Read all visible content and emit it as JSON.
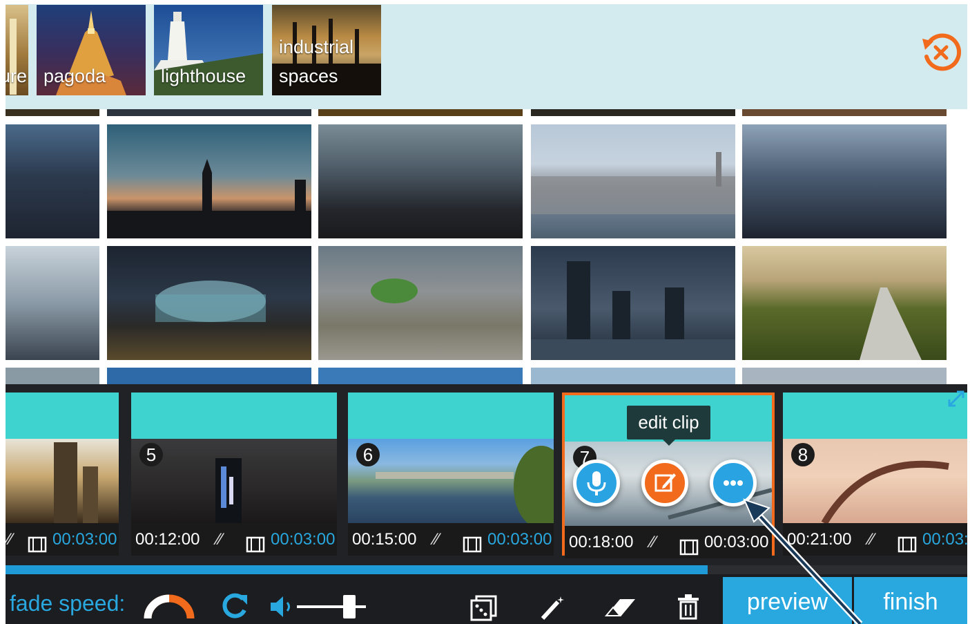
{
  "categories": [
    {
      "label": "ure"
    },
    {
      "label": "pagoda"
    },
    {
      "label": "lighthouse"
    },
    {
      "label_line1": "industrial",
      "label_line2": "spaces"
    }
  ],
  "timeline": {
    "clips": [
      {
        "number": "",
        "start": "",
        "length": "00:03:00"
      },
      {
        "number": "5",
        "start": "00:12:00",
        "length": "00:03:00"
      },
      {
        "number": "6",
        "start": "00:15:00",
        "length": "00:03:00"
      },
      {
        "number": "7",
        "start": "00:18:00",
        "length": "00:03:00",
        "selected": true
      },
      {
        "number": "8",
        "start": "00:21:00",
        "length": "00:03:"
      }
    ],
    "tooltip": "edit clip",
    "progress_fraction": 0.73
  },
  "toolbar": {
    "fade_label": "fade speed:",
    "preview_label": "preview",
    "finish_label": "finish"
  },
  "colors": {
    "accent_blue": "#29a8e0",
    "accent_orange": "#f26a1b",
    "clip_cyan": "#3fd3cf",
    "category_bar": "#d3ebef"
  },
  "icons": [
    "close-circle-icon",
    "expand-icon",
    "mic-icon",
    "edit-icon",
    "more-icon",
    "mute-icon",
    "film-icon",
    "fade-curve-icon",
    "refresh-icon",
    "volume-icon",
    "dice-icon",
    "magic-wand-icon",
    "eraser-icon",
    "trash-icon"
  ]
}
